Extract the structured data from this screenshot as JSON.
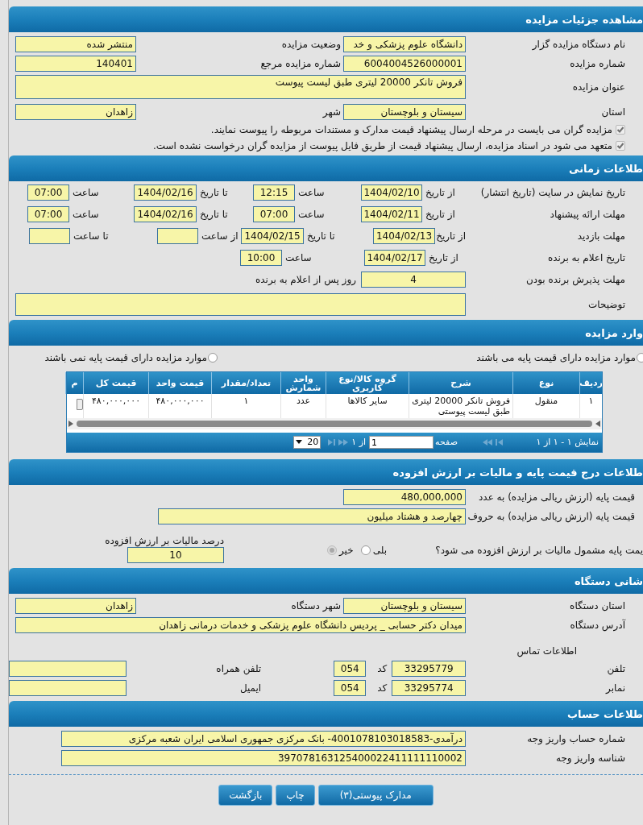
{
  "details": {
    "title": "مشاهده جزئیات مزایده",
    "fields": [
      {
        "label": "نام دستگاه مزایده گزار",
        "value": "دانشگاه علوم پزشکی و خد"
      },
      {
        "label": "وضعیت مزایده",
        "value": "منتشر شده"
      },
      {
        "label": "شماره مزایده",
        "value": "6004004526000001"
      },
      {
        "label": "شماره مزایده مرجع",
        "value": "140401"
      },
      {
        "label": "عنوان مزایده",
        "value": "فروش تانکر 20000 لیتری طبق لیست پیوست"
      },
      {
        "label": "استان",
        "value": "سیستان و بلوچستان"
      },
      {
        "label": "شهر",
        "value": "زاهدان"
      }
    ],
    "checks": [
      {
        "label": "مزایده گران می بایست در مرحله ارسال پیشنهاد قیمت مدارک و مستندات مربوطه را پیوست نمایند.",
        "checked": true
      },
      {
        "label": "متعهد می شود در اسناد مزایده، ارسال پیشنهاد قیمت از طریق فایل پیوست از مزایده گران درخواست نشده است.",
        "checked": true
      }
    ]
  },
  "timing": {
    "title": "طلاعات زمانی",
    "rows": [
      {
        "label": "تاریخ نمایش در سایت (تاریخ انتشار)",
        "pairs": [
          {
            "label": "از تاریخ",
            "value": "1404/02/10"
          },
          {
            "label": "ساعت",
            "value": "12:15"
          },
          {
            "label": "تا تاریخ",
            "value": "1404/02/16"
          },
          {
            "label": "ساعت",
            "value": "07:00"
          }
        ]
      },
      {
        "label": "مهلت ارائه پیشنهاد",
        "pairs": [
          {
            "label": "از تاریخ",
            "value": "1404/02/11"
          },
          {
            "label": "ساعت",
            "value": "07:00"
          },
          {
            "label": "تا تاریخ",
            "value": "1404/02/16"
          },
          {
            "label": "ساعت",
            "value": "07:00"
          }
        ]
      },
      {
        "label": "مهلت بازدید",
        "pairs": [
          {
            "label": "از تاریخ",
            "value": "1404/02/13"
          },
          {
            "label": "تا تاریخ",
            "value": "1404/02/15"
          },
          {
            "label": "از ساعت"
          },
          {
            "label": "تا ساعت"
          }
        ]
      },
      {
        "label": "تاریخ اعلام به برنده",
        "pairs": [
          {
            "label": "از تاریخ",
            "value": "1404/02/17"
          },
          {
            "label": "ساعت",
            "value": "10:00"
          }
        ]
      }
    ],
    "acceptance": {
      "label": "مهلت پذیرش برنده بودن",
      "value": "4",
      "suffix": "روز پس از اعلام به برنده"
    },
    "notes": {
      "label": "توضیحات"
    }
  },
  "items": {
    "title": "وارد مزایده",
    "radios": [
      {
        "label": "موارد مزایده دارای قیمت پایه می باشند",
        "selected": false
      },
      {
        "label": "موارد مزایده دارای قیمت پایه نمی باشند",
        "selected": false
      }
    ],
    "table": {
      "columns": [
        "ردیف",
        "نوع",
        "شرح",
        "گروه کالا/نوع کاربری",
        "واحد شمارش",
        "تعداد/مقدار",
        "قیمت واحد",
        "قیمت کل",
        "م"
      ],
      "rows": [
        [
          "۱",
          "منقول",
          "فروش تانکر 20000 لیتری طبق لیست پیوستی",
          "سایر کالاها",
          "عدد",
          "۱",
          "۴۸۰,۰۰۰,۰۰۰",
          "۴۸۰,۰۰۰,۰۰۰"
        ]
      ]
    },
    "pager": {
      "summary": "نمایش ۱ - ۱ از ۱",
      "page_label": "صفحه",
      "page": "1",
      "of": "از ۱",
      "page_size": "20"
    }
  },
  "price": {
    "title": "طلاعات درج قیمت پایه و مالیات بر ارزش افزوده",
    "number": {
      "label": "قیمت پایه (ارزش ریالی مزایده) به عدد",
      "value": "480,000,000"
    },
    "words": {
      "label": "قیمت پایه (ارزش ریالی مزایده) به حروف",
      "value": "چهارصد و هشتاد میلیون"
    },
    "vat_question": "یمت پایه مشمول مالیات بر ارزش افزوده می شود؟",
    "vat_options": [
      {
        "label": "بلی",
        "selected": false
      },
      {
        "label": "خیر",
        "selected": true
      }
    ],
    "vat_percent": {
      "label": "درصد مالیات بر ارزش افزوده",
      "value": "10"
    }
  },
  "address": {
    "title": "شانی دستگاه",
    "province": {
      "label": "استان دستگاه",
      "value": "سیستان و بلوچستان"
    },
    "city": {
      "label": "شهر دستگاه",
      "value": "زاهدان"
    },
    "street": {
      "label": "آدرس دستگاه",
      "value": "میدان دکتر حسابی _ پردیس دانشگاه علوم پزشکی و خدمات درمانی زاهدان"
    },
    "contact_title": "اطلاعات تماس",
    "contacts": [
      {
        "label": "تلفن",
        "value": "33295779",
        "code_label": "کد",
        "code": "054",
        "other_label": "تلفن همراه"
      },
      {
        "label": "نمابر",
        "value": "33295774",
        "code_label": "کد",
        "code": "054",
        "other_label": "ایمیل"
      }
    ]
  },
  "account": {
    "title": "طلاعات حساب",
    "fields": [
      {
        "label": "شماره حساب واریز وجه",
        "value": "درآمدی-4001078103018583- بانک مرکزی جمهوری اسلامی ایران شعبه مرکزی"
      },
      {
        "label": "شناسه واریز وجه",
        "value": "397078163125400022411111110002"
      }
    ]
  },
  "buttons": [
    "مدارک پیوستی(۳)",
    "چاپ",
    "بازگشت"
  ]
}
